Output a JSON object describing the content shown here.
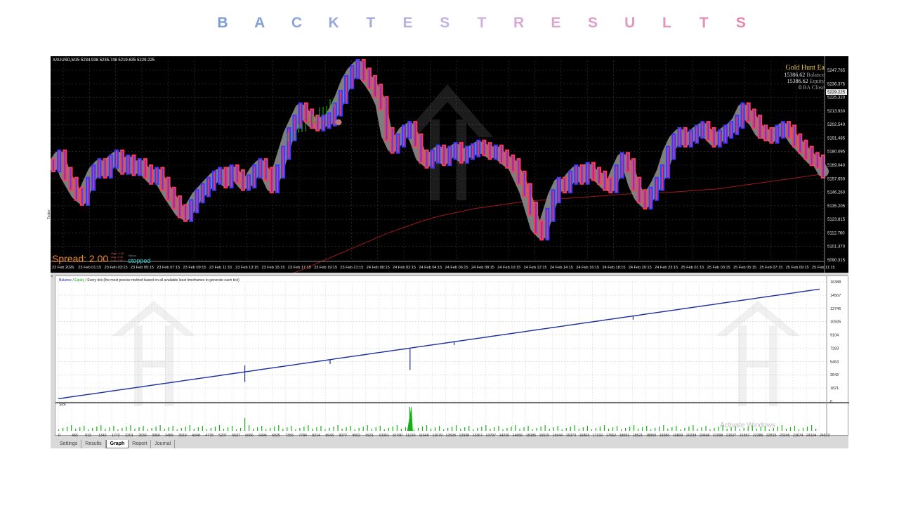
{
  "headline": {
    "letters": [
      "B",
      "A",
      "C",
      "K",
      "T",
      "E",
      "S",
      "T",
      "R",
      "E",
      "S",
      "U",
      "L",
      "T",
      "S"
    ],
    "colors": [
      "#7a9cd4",
      "#7fa1d6",
      "#8ca4d9",
      "#98a7dc",
      "#a6abde",
      "#b7b0e0",
      "#c4b3e2",
      "#d0b2df",
      "#d6abd6",
      "#dba6cf",
      "#e09fc8",
      "#e29ac2",
      "#e694bc",
      "#e88db5",
      "#e987ad"
    ]
  },
  "price_chart": {
    "symbol_info": "XAUUSD,M15  5234.938 5235.748 5219.635 5229.225",
    "ea_name": "Gold Hunt Ea",
    "balance_value": "15386.62",
    "balance_label": "Balance",
    "equity_value": "15386.62",
    "equity_label": "Equity",
    "close_value": "0",
    "close_label": "BA Close",
    "current_price": "5229.225",
    "spread_text": "Spread: 2.00",
    "spread_mini": [
      "High: 2.00",
      "Avg: 2.00",
      "Low: 2.00"
    ],
    "status_label": "Status",
    "status_value": "stopped",
    "y_ticks": [
      "5247.765",
      "5236.375",
      "5225.320",
      "5213.930",
      "5202.540",
      "5191.485",
      "5180.095",
      "5169.040",
      "5157.650",
      "5146.260",
      "5135.205",
      "5123.815",
      "5112.760",
      "5101.370",
      "5090.315"
    ],
    "x_ticks": [
      "22 Feb 2026",
      "23 Feb 01:15",
      "23 Feb 03:15",
      "23 Feb 05:15",
      "23 Feb 07:15",
      "23 Feb 09:15",
      "23 Feb 11:15",
      "23 Feb 13:15",
      "23 Feb 15:15",
      "23 Feb 17:15",
      "23 Feb 19:15",
      "23 Feb 21:15",
      "24 Feb 00:15",
      "24 Feb 02:15",
      "24 Feb 04:15",
      "24 Feb 06:15",
      "24 Feb 08:15",
      "24 Feb 10:15",
      "24 Feb 12:15",
      "24 Feb 14:15",
      "24 Feb 16:15",
      "24 Feb 18:15",
      "24 Feb 20:15",
      "24 Feb 23:15",
      "25 Feb 01:15",
      "25 Feb 03:15",
      "25 Feb 05:15",
      "25 Feb 07:15",
      "25 Feb 09:15",
      "25 Feb 11:15"
    ],
    "y_min": 5090.315,
    "y_max": 5247.765,
    "price_path": [
      5165,
      5172,
      5158,
      5150,
      5142,
      5138,
      5150,
      5160,
      5165,
      5160,
      5168,
      5172,
      5163,
      5168,
      5162,
      5165,
      5160,
      5155,
      5158,
      5150,
      5142,
      5135,
      5128,
      5125,
      5132,
      5140,
      5145,
      5150,
      5155,
      5158,
      5152,
      5160,
      5156,
      5150,
      5152,
      5160,
      5165,
      5158,
      5148,
      5160,
      5175,
      5190,
      5200,
      5210,
      5205,
      5200,
      5198,
      5200,
      5202,
      5210,
      5220,
      5232,
      5240,
      5245,
      5238,
      5232,
      5225,
      5215,
      5190,
      5180,
      5185,
      5192,
      5195,
      5185,
      5172,
      5168,
      5172,
      5176,
      5170,
      5175,
      5178,
      5172,
      5175,
      5177,
      5180,
      5178,
      5175,
      5176,
      5172,
      5168,
      5165,
      5155,
      5145,
      5130,
      5115,
      5110,
      5125,
      5140,
      5150,
      5148,
      5155,
      5160,
      5155,
      5162,
      5158,
      5155,
      5150,
      5148,
      5160,
      5170,
      5165,
      5150,
      5140,
      5135,
      5142,
      5150,
      5160,
      5175,
      5185,
      5190,
      5185,
      5188,
      5192,
      5195,
      5190,
      5185,
      5188,
      5192,
      5195,
      5200,
      5210,
      5205,
      5200,
      5192,
      5190,
      5188,
      5192,
      5195,
      5192,
      5185,
      5180,
      5175,
      5170,
      5168,
      5160
    ],
    "ma_path": [
      5075,
      5080,
      5086,
      5092,
      5098,
      5104,
      5110,
      5115,
      5120,
      5124,
      5127,
      5130,
      5132,
      5134,
      5136,
      5137,
      5138,
      5139,
      5140,
      5141,
      5142,
      5143,
      5143,
      5144,
      5145,
      5146,
      5148,
      5150,
      5152,
      5154,
      5156,
      5158
    ],
    "colors": {
      "candle_up": "#3a3aff",
      "candle_down": "#ff3b54",
      "halo": "#8c8c8c",
      "ma": "#a01818",
      "green": "#18c218"
    }
  },
  "tester_graph": {
    "caption_balance": "Balance",
    "caption_sep1": " / ",
    "caption_equity": "Equity",
    "caption_rest": " / Every tick (the most precise method based on all available least timeframes to generate each tick)",
    "size_label": "Size",
    "side_label": "Tester",
    "close_icon": "close-icon",
    "activate_text": "Activate Windows",
    "y_ticks": [
      "16388",
      "14567",
      "12746",
      "10925",
      "9104",
      "7283",
      "5463",
      "3642",
      "1821",
      "0"
    ],
    "x_ticks": [
      "0",
      "483",
      "913",
      "1342",
      "1772",
      "2201",
      "2630",
      "3060",
      "3489",
      "3919",
      "4348",
      "4778",
      "5207",
      "5637",
      "6066",
      "6496",
      "6925",
      "7355",
      "7784",
      "8214",
      "8643",
      "9072",
      "9502",
      "9931",
      "10361",
      "10790",
      "11220",
      "11649",
      "12079",
      "12508",
      "12938",
      "13367",
      "13797",
      "14226",
      "14656",
      "15085",
      "15515",
      "15944",
      "16373",
      "16803",
      "17232",
      "17662",
      "18091",
      "18521",
      "18950",
      "19380",
      "19809",
      "20239",
      "20668",
      "21098",
      "21527",
      "21957",
      "22386",
      "22815",
      "23245",
      "23674",
      "24104",
      "24533"
    ],
    "y_max": 16388,
    "balance_start": 350,
    "balance_end": 15386.62,
    "colors": {
      "balance": "#1b2fa0",
      "equity": "#1aa81a",
      "volume": "#16b016"
    }
  },
  "tabs": [
    "Settings",
    "Results",
    "Graph",
    "Report",
    "Journal"
  ],
  "active_tab": "Graph"
}
